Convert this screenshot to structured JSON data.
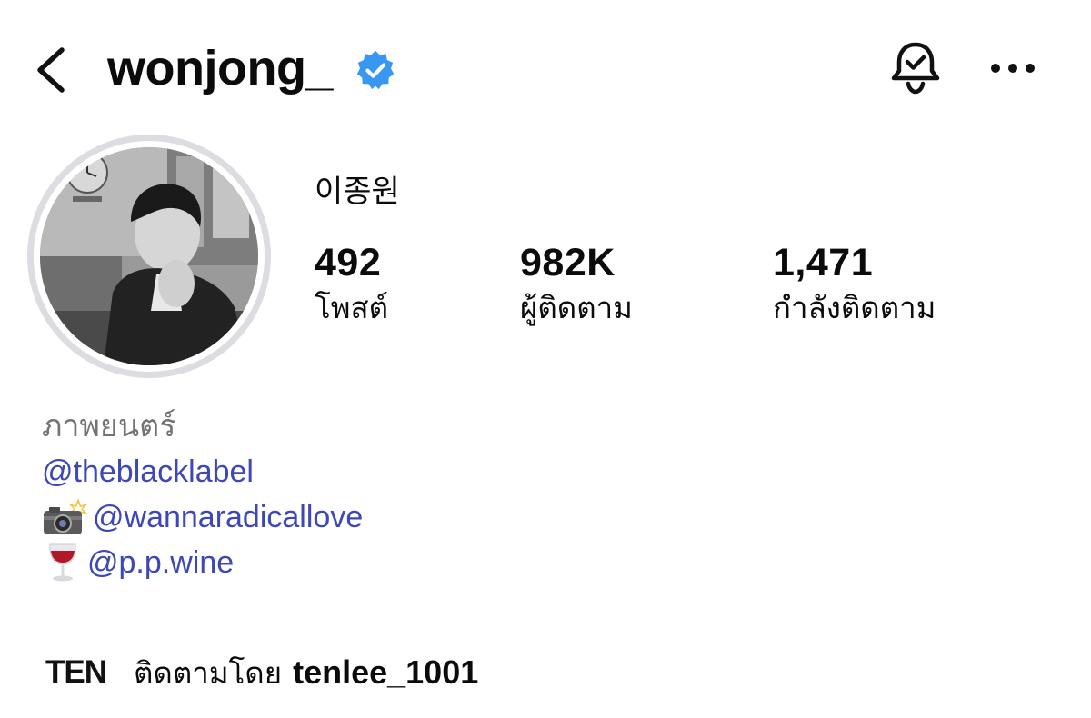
{
  "header": {
    "username": "wonjong_",
    "verified": true,
    "back_icon": "chevron-left-icon",
    "notification_icon": "bell-check-icon",
    "more_icon": "ellipsis-icon"
  },
  "profile": {
    "display_name": "이종원",
    "avatar": "profile-photo-grayscale"
  },
  "stats": {
    "posts": {
      "value": "492",
      "label": "โพสต์"
    },
    "followers": {
      "value": "982K",
      "label": "ผู้ติดตาม"
    },
    "following": {
      "value": "1,471",
      "label": "กำลังติดตาม"
    }
  },
  "bio": {
    "category": "ภาพยนตร์",
    "links": [
      {
        "emoji": "",
        "text": "@theblacklabel"
      },
      {
        "emoji": "camera-flash-emoji",
        "text": "@wannaradicallove"
      },
      {
        "emoji": "wine-glass-emoji",
        "text": "@p.p.wine"
      }
    ]
  },
  "followed_by": {
    "badge": "TEN",
    "prefix": "ติดตามโดย",
    "user": "tenlee_1001"
  },
  "colors": {
    "link": "#3d47b8",
    "verified": "#3897f0",
    "muted": "#737373",
    "ring": "#dcdde1"
  }
}
